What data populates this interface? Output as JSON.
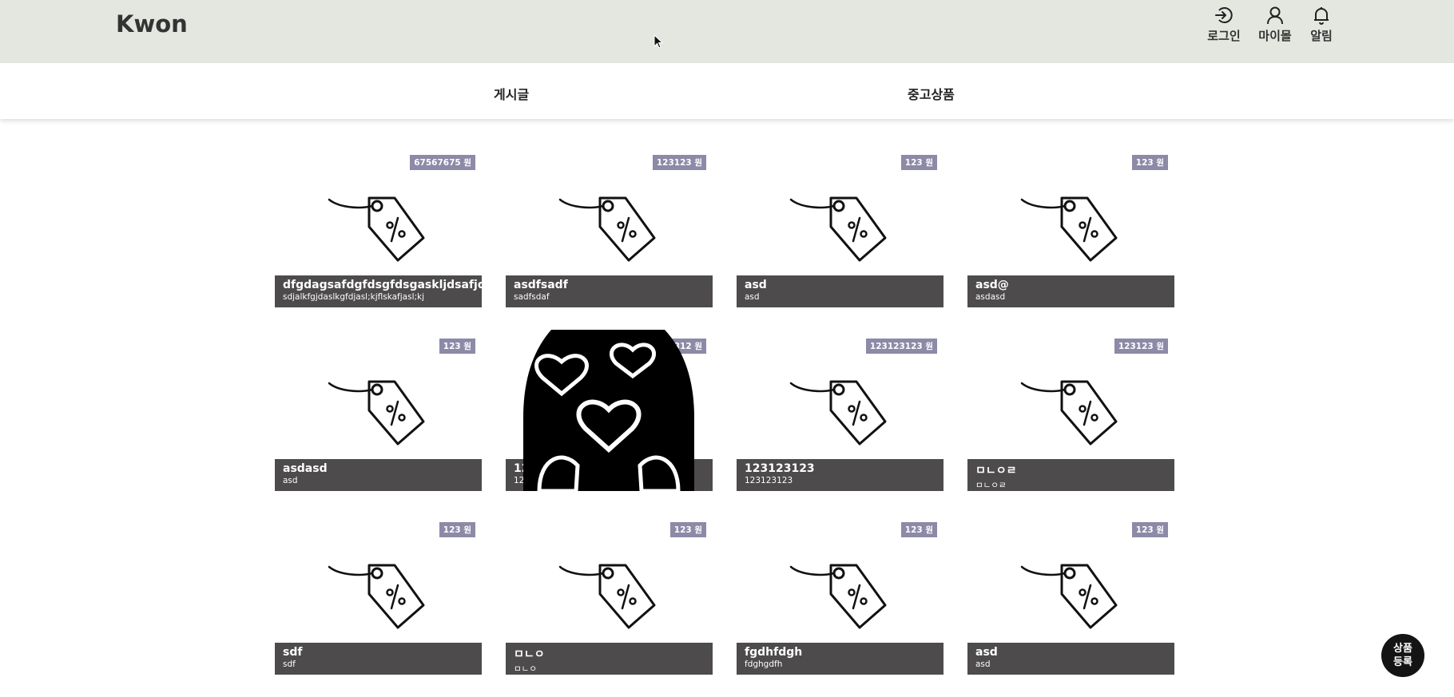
{
  "header": {
    "logo": "Kwon",
    "login_label": "로그인",
    "mypage_label": "마이몰",
    "alarm_label": "알림"
  },
  "tabs": [
    "게시글",
    "중고상품"
  ],
  "products": [
    {
      "price": "67567675 원",
      "title": "dfgdagsafdgfdsgfdsgaskljdsafjdsklafjkl;",
      "desc": "sdjalkfgjdaslkgfdjasl;kjflskafjasl;kj"
    },
    {
      "price": "123123 원",
      "title": "asdfsadf",
      "desc": "sadfsdaf"
    },
    {
      "price": "123 원",
      "title": "asd",
      "desc": "asd"
    },
    {
      "price": "123 원",
      "title": "asd@",
      "desc": "asdasd"
    },
    {
      "price": "123 원",
      "title": "asdasd",
      "desc": "asd"
    },
    {
      "price": "123312 원",
      "title": "1234",
      "desc": "1234"
    },
    {
      "price": "123123123 원",
      "title": "123123123",
      "desc": "123123123"
    },
    {
      "price": "123123 원",
      "title": "ㅁㄴㅇㄹ",
      "desc": "ㅁㄴㅇㄹ"
    },
    {
      "price": "123 원",
      "title": "sdf",
      "desc": "sdf"
    },
    {
      "price": "123 원",
      "title": "ㅁㄴㅇ",
      "desc": "ㅁㄴㅇ"
    },
    {
      "price": "123 원",
      "title": "fgdhfdgh",
      "desc": "fdghgdfh"
    },
    {
      "price": "123 원",
      "title": "asd",
      "desc": "asd"
    }
  ],
  "fab": {
    "line1": "상품",
    "line2": "등록"
  }
}
